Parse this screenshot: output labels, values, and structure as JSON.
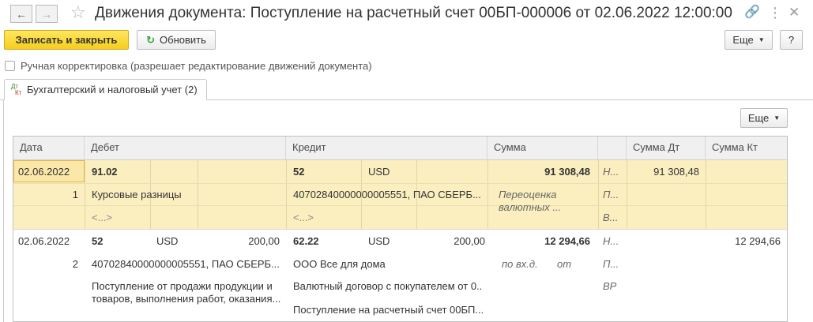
{
  "window": {
    "title": "Движения документа: Поступление на расчетный счет 00БП-000006 от 02.06.2022 12:00:00",
    "back_icon": "arrow-left-icon",
    "forward_icon": "arrow-right-icon",
    "favorite_icon": "star-icon",
    "link_icon": "link-icon",
    "more_icon": "more-vertical-icon",
    "close_icon": "close-icon"
  },
  "toolbar": {
    "save_close_label": "Записать и закрыть",
    "refresh_label": "Обновить",
    "more_label": "Еще",
    "help_label": "?"
  },
  "manual_correction": {
    "label": "Ручная корректировка (разрешает редактирование движений документа)",
    "checked": false
  },
  "tab": {
    "icon_top": "Дт",
    "icon_bottom": "Кт",
    "label": "Бухгалтерский и налоговый учет (2)"
  },
  "grid_toolbar": {
    "more_label": "Еще"
  },
  "columns": {
    "date": "Дата",
    "debit": "Дебет",
    "credit": "Кредит",
    "sum": "Сумма",
    "sum_dt": "Сумма Дт",
    "sum_kt": "Сумма Кт"
  },
  "rows": [
    {
      "date": "02.06.2022",
      "num": "1",
      "debit_account": "91.02",
      "debit_currency": "",
      "debit_amount": "",
      "debit_sub1": "Курсовые разницы",
      "debit_sub2": "<...>",
      "credit_account": "52",
      "credit_currency": "USD",
      "credit_amount": "",
      "credit_sub1": "40702840000000005551, ПАО СБЕРБ...",
      "credit_sub2": "<...>",
      "sum": "91 308,48",
      "sum_note_line1": "Переоценка",
      "sum_note_line2": "валютных ...",
      "flag1": "Н...",
      "flag2": "П...",
      "flag3": "В...",
      "sum_dt": "91 308,48",
      "sum_kt": ""
    },
    {
      "date": "02.06.2022",
      "num": "2",
      "debit_account": "52",
      "debit_currency": "USD",
      "debit_amount": "200,00",
      "debit_sub1": "40702840000000005551, ПАО СБЕРБ...",
      "debit_sub2": "Поступление от продажи продукции и",
      "debit_sub3": "товаров, выполнения работ, оказания...",
      "credit_account": "62.22",
      "credit_currency": "USD",
      "credit_amount": "200,00",
      "credit_sub1": "ООО Все для дома",
      "credit_sub2": "Валютный договор с покупателем от 0...",
      "credit_sub3": "Поступление на расчетный счет 00БП...",
      "sum": "12 294,66",
      "sum_note_left": "по вх.д.",
      "sum_note_right": "от",
      "flag1": "Н...",
      "flag2": "П...",
      "flag3": "ВР",
      "sum_dt": "",
      "sum_kt": "12 294,66"
    }
  ]
}
